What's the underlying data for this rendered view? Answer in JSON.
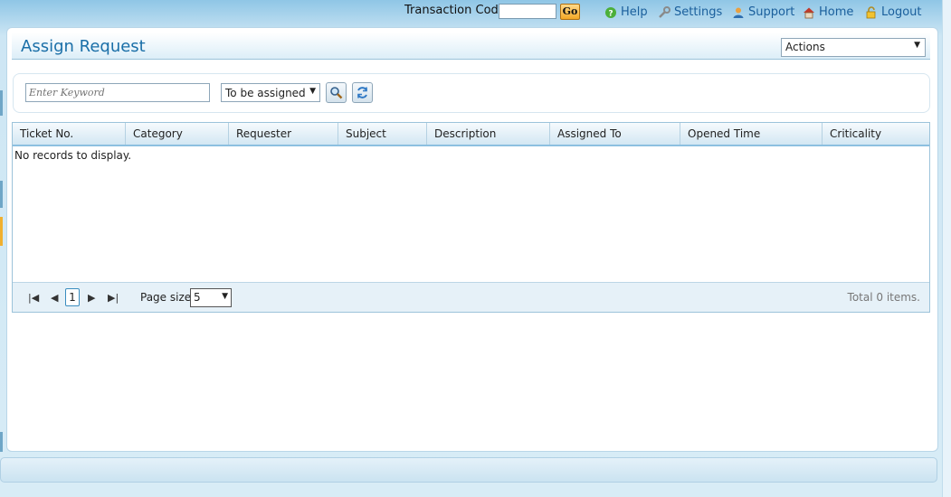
{
  "topbar": {
    "transaction_label": "Transaction Code",
    "transaction_value": "",
    "go_label": "Go",
    "links": [
      {
        "label": "Help",
        "icon": "help-icon"
      },
      {
        "label": "Settings",
        "icon": "wrench-icon"
      },
      {
        "label": "Support",
        "icon": "support-user-icon"
      },
      {
        "label": "Home",
        "icon": "home-icon"
      },
      {
        "label": "Logout",
        "icon": "lock-icon"
      }
    ]
  },
  "page": {
    "title": "Assign Request",
    "actions_label": "Actions"
  },
  "search": {
    "placeholder": "Enter Keyword",
    "status_selected": "To be assigned"
  },
  "grid": {
    "columns": [
      "Ticket No.",
      "Category",
      "Requester",
      "Subject",
      "Description",
      "Assigned To",
      "Opened Time",
      "Criticality"
    ],
    "empty_text": "No records to display."
  },
  "pager": {
    "current_page": "1",
    "page_size_label": "Page size:",
    "page_size_value": "5",
    "total_text": "Total 0 items."
  },
  "colors": {
    "accent": "#1a6fa8",
    "header_bg": "#d3e7f3",
    "background": "#cde6f4"
  }
}
